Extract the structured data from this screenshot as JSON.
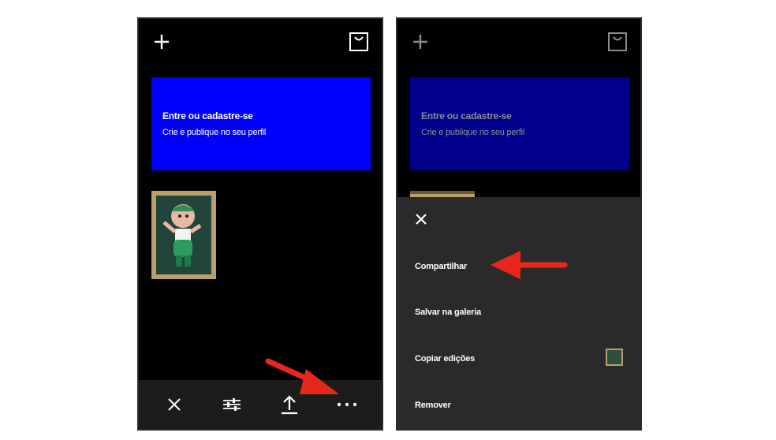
{
  "left": {
    "banner": {
      "title": "Entre ou cadastre-se",
      "subtitle": "Crie e publique no seu perfil"
    }
  },
  "right": {
    "banner": {
      "title": "Entre ou cadastre-se",
      "subtitle": "Crie e publique no seu perfil"
    },
    "menu": {
      "share": "Compartilhar",
      "save": "Salvar na galeria",
      "copy": "Copiar edições",
      "remove": "Remover"
    }
  },
  "colors": {
    "banner": "#0000ff",
    "annotation_arrow": "#e8271b",
    "frame": "#b9a06a"
  },
  "icons": [
    "plus-icon",
    "shopping-bag-icon",
    "close-icon",
    "sliders-icon",
    "upload-icon",
    "more-dots-icon"
  ]
}
